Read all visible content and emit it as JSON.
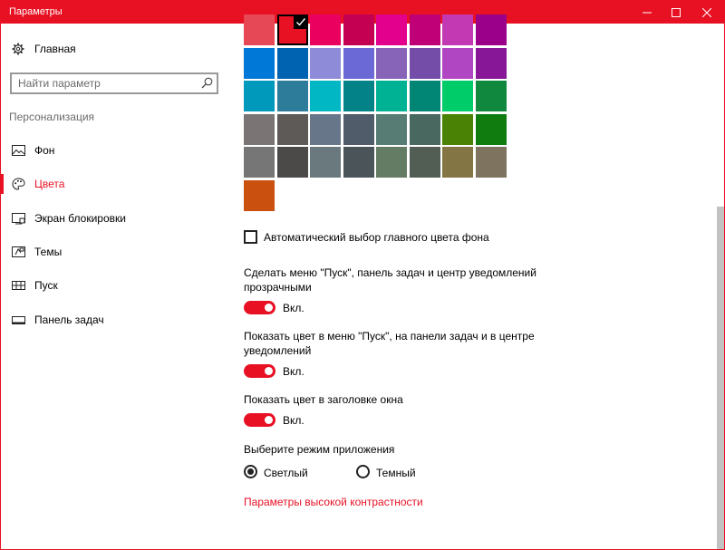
{
  "window": {
    "title": "Параметры"
  },
  "sidebar": {
    "home_label": "Главная",
    "search_placeholder": "Найти параметр",
    "section_label": "Персонализация",
    "items": [
      {
        "label": "Фон",
        "icon": "image-icon",
        "active": false
      },
      {
        "label": "Цвета",
        "icon": "palette-icon",
        "active": true
      },
      {
        "label": "Экран блокировки",
        "icon": "lock-screen-icon",
        "active": false
      },
      {
        "label": "Темы",
        "icon": "themes-icon",
        "active": false
      },
      {
        "label": "Пуск",
        "icon": "start-icon",
        "active": false
      },
      {
        "label": "Панель задач",
        "icon": "taskbar-icon",
        "active": false
      }
    ]
  },
  "colors": {
    "accent": "#e81123",
    "selected": "#e81123",
    "swatch_rows": [
      [
        "#e74856",
        "#e81123",
        "#ea005e",
        "#c30052",
        "#e3008c",
        "#bf0077",
        "#c239b3",
        "#9a0089"
      ],
      [
        "#0078d7",
        "#0063b1",
        "#8e8cd8",
        "#6b69d6",
        "#8764b8",
        "#744da9",
        "#b146c2",
        "#881798"
      ],
      [
        "#0099bc",
        "#2d7d9a",
        "#00b7c3",
        "#038387",
        "#00b294",
        "#018574",
        "#00cc6a",
        "#10893e"
      ],
      [
        "#7a7574",
        "#5d5a58",
        "#68768a",
        "#515c6b",
        "#567c73",
        "#486860",
        "#498205",
        "#107c10"
      ],
      [
        "#767676",
        "#4c4a48",
        "#69797e",
        "#4a5459",
        "#647c64",
        "#525e54",
        "#847545",
        "#7e735f"
      ],
      [
        "#ca5010"
      ]
    ]
  },
  "settings": {
    "auto_color_label": "Автоматический выбор главного цвета фона",
    "auto_color_checked": false,
    "transparency_label": "Сделать меню \"Пуск\", панель задач и центр уведомлений прозрачными",
    "transparency_state": "Вкл.",
    "show_color_label": "Показать цвет в меню \"Пуск\", на панели задач и в центре уведомлений",
    "show_color_state": "Вкл.",
    "title_color_label": "Показать цвет в заголовке окна",
    "title_color_state": "Вкл.",
    "app_mode_label": "Выберите режим приложения",
    "mode_light": "Светлый",
    "mode_dark": "Темный",
    "selected_mode": "light",
    "high_contrast_link": "Параметры высокой контрастности"
  }
}
